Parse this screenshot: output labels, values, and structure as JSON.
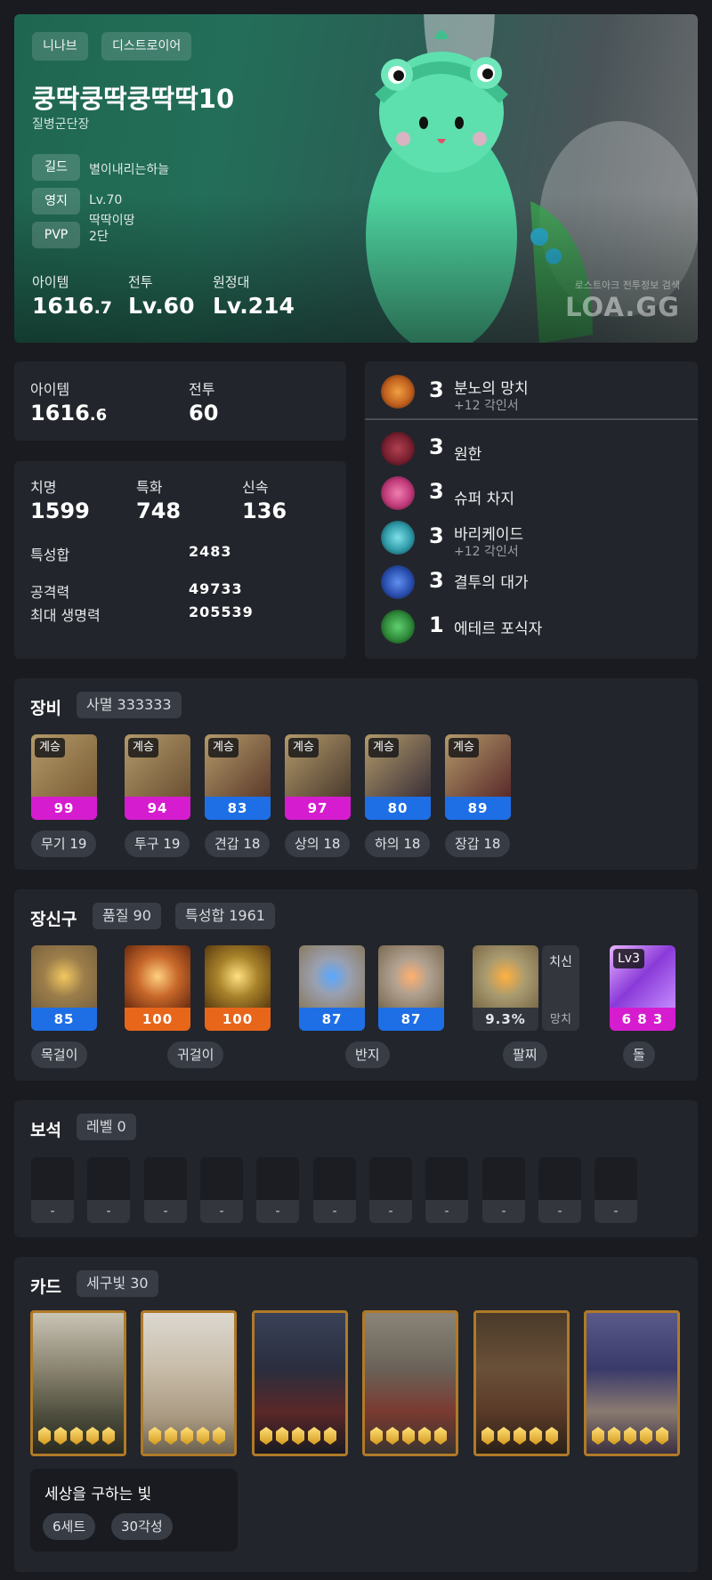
{
  "hero": {
    "server": "니나브",
    "class": "디스트로이어",
    "name": "쿵딱쿵딱쿵딱딱10",
    "title": "질병군단장",
    "guild_label": "길드",
    "guild": "별이내리는하늘",
    "estate_label": "영지",
    "estate_level": "Lv.70",
    "estate_name": "딱딱이땅",
    "pvp_label": "PVP",
    "pvp": "2단",
    "item_label": "아이템",
    "item_int": "1616",
    "item_dec": ".7",
    "combat_label": "전투",
    "combat": "Lv.60",
    "expedition_label": "원정대",
    "expedition": "Lv.214",
    "watermark_sub": "로스트아크 전투정보 검색",
    "watermark_main": "LOA.GG"
  },
  "summary": {
    "item_label": "아이템",
    "item_int": "1616",
    "item_dec": ".6",
    "combat_label": "전투",
    "combat": "60"
  },
  "stats": {
    "crit_label": "치명",
    "crit": "1599",
    "spec_label": "특화",
    "spec": "748",
    "swift_label": "신속",
    "swift": "136",
    "sum_label": "특성합",
    "sum": "2483",
    "atk_label": "공격력",
    "atk": "49733",
    "hp_label": "최대 생명력",
    "hp": "205539"
  },
  "engravings": [
    {
      "level": "3",
      "name": "분노의 망치",
      "sub": "+12 각인서",
      "icon": "hammer-icon",
      "color": "#c0601e"
    },
    {
      "level": "3",
      "name": "원한",
      "sub": "",
      "icon": "grudge-icon",
      "color": "#7a2030"
    },
    {
      "level": "3",
      "name": "슈퍼 차지",
      "sub": "",
      "icon": "super-charge-icon",
      "color": "#c03a7a"
    },
    {
      "level": "3",
      "name": "바리케이드",
      "sub": "+12 각인서",
      "icon": "barricade-icon",
      "color": "#2f9aa8"
    },
    {
      "level": "3",
      "name": "결투의 대가",
      "sub": "",
      "icon": "duel-icon",
      "color": "#2a4fb0"
    },
    {
      "level": "1",
      "name": "에테르 포식자",
      "sub": "",
      "icon": "ether-icon",
      "color": "#2f8a3a"
    }
  ],
  "equipment": {
    "title": "장비",
    "tag": "사멸 333333",
    "inherit_label": "계승",
    "items": [
      {
        "quality": "99",
        "label": "무기 19",
        "bar_color": "#d61ccf",
        "icon": "weapon-icon"
      },
      {
        "quality": "94",
        "label": "투구 19",
        "bar_color": "#d61ccf",
        "icon": "helmet-icon"
      },
      {
        "quality": "83",
        "label": "견갑 18",
        "bar_color": "#1e6fe6",
        "icon": "shoulder-icon"
      },
      {
        "quality": "97",
        "label": "상의 18",
        "bar_color": "#d61ccf",
        "icon": "chest-icon"
      },
      {
        "quality": "80",
        "label": "하의 18",
        "bar_color": "#1e6fe6",
        "icon": "pants-icon"
      },
      {
        "quality": "89",
        "label": "장갑 18",
        "bar_color": "#1e6fe6",
        "icon": "gloves-icon"
      }
    ]
  },
  "accessories": {
    "title": "장신구",
    "quality_tag": "품질 90",
    "sum_tag": "특성합 1961",
    "items": [
      {
        "value": "85",
        "bar_color": "#1e6fe6",
        "icon": "necklace-icon"
      },
      {
        "value": "100",
        "bar_color": "#e8661a",
        "icon": "earring-icon"
      },
      {
        "value": "100",
        "bar_color": "#e8661a",
        "icon": "earring-icon"
      },
      {
        "value": "87",
        "bar_color": "#1e6fe6",
        "icon": "ring-icon"
      },
      {
        "value": "87",
        "bar_color": "#1e6fe6",
        "icon": "ring-icon"
      },
      {
        "value": "9.3%",
        "bar_color": "#33363d",
        "icon": "bracelet-icon"
      },
      {
        "value": "6 8 3",
        "bar_color": "#d61ccf",
        "icon": "ability-stone-icon"
      }
    ],
    "bracelet_stat1": "치신",
    "bracelet_stat2": "망치",
    "stone_level": "Lv3",
    "labels": {
      "necklace": "목걸이",
      "earring": "귀걸이",
      "ring": "반지",
      "bracelet": "팔찌",
      "stone": "돌"
    }
  },
  "gems": {
    "title": "보석",
    "tag": "레벨 0",
    "slots": [
      "-",
      "-",
      "-",
      "-",
      "-",
      "-",
      "-",
      "-",
      "-",
      "-",
      "-"
    ]
  },
  "cards": {
    "title": "카드",
    "tag": "세구빛 30",
    "set_name": "세상을 구하는 빛",
    "set_count": "6세트",
    "awaken": "30각성",
    "items": [
      {
        "name": "card-1"
      },
      {
        "name": "card-2"
      },
      {
        "name": "card-3"
      },
      {
        "name": "card-4"
      },
      {
        "name": "card-5"
      },
      {
        "name": "card-6"
      }
    ]
  }
}
